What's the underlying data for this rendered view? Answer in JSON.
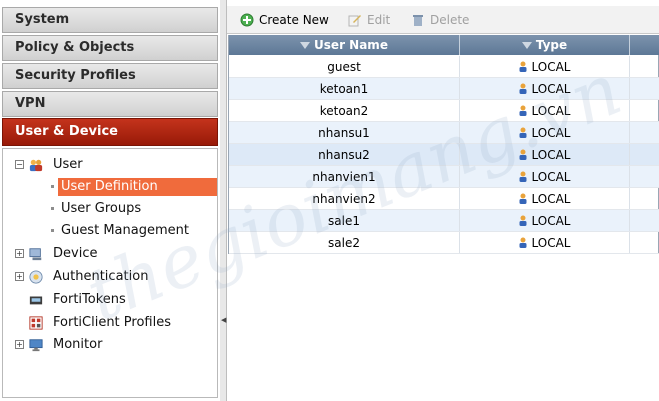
{
  "nav": {
    "system": "System",
    "policy_objects": "Policy & Objects",
    "security_profiles": "Security Profiles",
    "vpn": "VPN",
    "user_device": "User & Device"
  },
  "tree": {
    "user": "User",
    "user_definition": "User Definition",
    "user_groups": "User Groups",
    "guest_management": "Guest Management",
    "device": "Device",
    "authentication": "Authentication",
    "fortitokens": "FortiTokens",
    "forticlient_profiles": "FortiClient Profiles",
    "monitor": "Monitor"
  },
  "toolbar": {
    "create_new": "Create New",
    "edit": "Edit",
    "delete": "Delete"
  },
  "table": {
    "columns": [
      "User Name",
      "Type"
    ],
    "rows": [
      {
        "user_name": "guest",
        "type": "LOCAL"
      },
      {
        "user_name": "ketoan1",
        "type": "LOCAL"
      },
      {
        "user_name": "ketoan2",
        "type": "LOCAL"
      },
      {
        "user_name": "nhansu1",
        "type": "LOCAL"
      },
      {
        "user_name": "nhansu2",
        "type": "LOCAL"
      },
      {
        "user_name": "nhanvien1",
        "type": "LOCAL"
      },
      {
        "user_name": "nhanvien2",
        "type": "LOCAL"
      },
      {
        "user_name": "sale1",
        "type": "LOCAL"
      },
      {
        "user_name": "sale2",
        "type": "LOCAL"
      }
    ]
  },
  "watermark": "thegioimang.vn",
  "colors": {
    "active_nav": "#b3270f",
    "selected_item": "#f06b3c",
    "grid_header": "#6b84a1",
    "row_alt": "#eaf2fb"
  }
}
